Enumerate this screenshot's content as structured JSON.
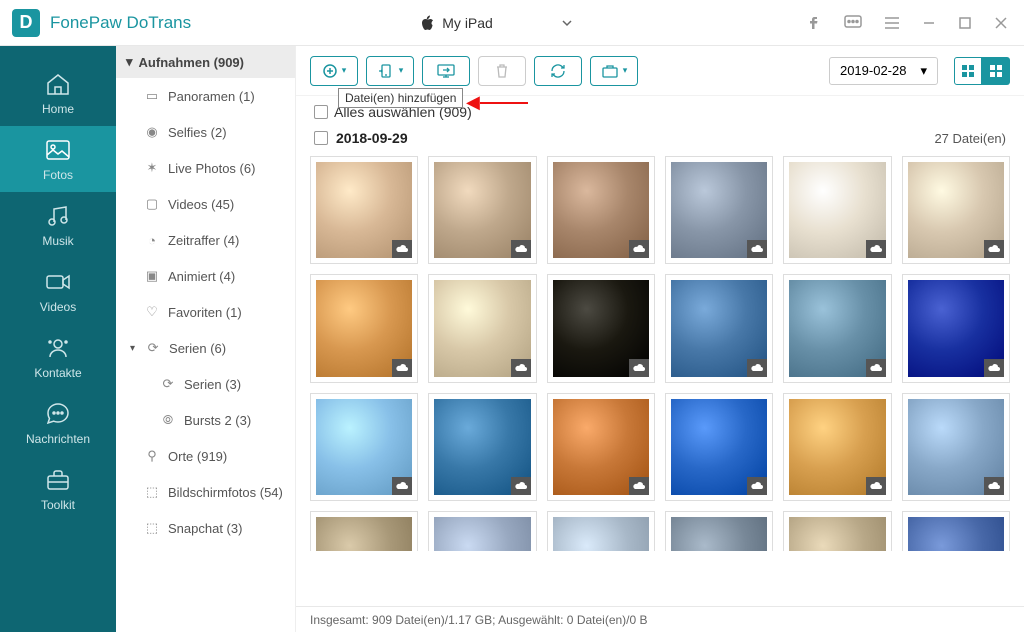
{
  "app": {
    "title": "FonePaw DoTrans",
    "device": "My iPad"
  },
  "nav": [
    {
      "key": "home",
      "label": "Home"
    },
    {
      "key": "fotos",
      "label": "Fotos"
    },
    {
      "key": "musik",
      "label": "Musik"
    },
    {
      "key": "videos",
      "label": "Videos"
    },
    {
      "key": "kontakte",
      "label": "Kontakte"
    },
    {
      "key": "nachrichten",
      "label": "Nachrichten"
    },
    {
      "key": "toolkit",
      "label": "Toolkit"
    }
  ],
  "sidebar": {
    "header": "Aufnahmen (909)",
    "items": [
      {
        "label": "Panoramen (1)"
      },
      {
        "label": "Selfies (2)"
      },
      {
        "label": "Live Photos (6)"
      },
      {
        "label": "Videos (45)"
      },
      {
        "label": "Zeitraffer (4)"
      },
      {
        "label": "Animiert (4)"
      },
      {
        "label": "Favoriten (1)"
      },
      {
        "label": "Serien (6)",
        "expandable": true
      },
      {
        "label": "Serien (3)",
        "sub": true
      },
      {
        "label": "Bursts 2 (3)",
        "sub": true
      },
      {
        "label": "Orte (919)"
      },
      {
        "label": "Bildschirmfotos (54)"
      },
      {
        "label": "Snapchat (3)"
      }
    ]
  },
  "toolbar": {
    "tooltip": "Datei(en) hinzufügen",
    "date": "2019-02-28"
  },
  "selectAll": {
    "label": "Alles auswählen (909)"
  },
  "group": {
    "date": "2018-09-29",
    "count": "27 Datei(en)"
  },
  "thumbs": {
    "row1": [
      "#d8b896",
      "#bfa88c",
      "#a8866b",
      "#8896a8",
      "#e8e0d0",
      "#d8c8b0"
    ],
    "row2": [
      "#d89850",
      "#d8c8a8",
      "#1a1810",
      "#4878a8",
      "#6890a8",
      "#1830a0"
    ],
    "row3": [
      "#88c0e8",
      "#3878a8",
      "#c87838",
      "#2868c8",
      "#d8a050",
      "#88a8c8"
    ],
    "row4": [
      "#a89878",
      "#98a8c0",
      "#a8b8c8",
      "#788898",
      "#b8a888",
      "#4868a8"
    ]
  },
  "status": "Insgesamt: 909 Datei(en)/1.17 GB; Ausgewählt: 0 Datei(en)/0 B"
}
